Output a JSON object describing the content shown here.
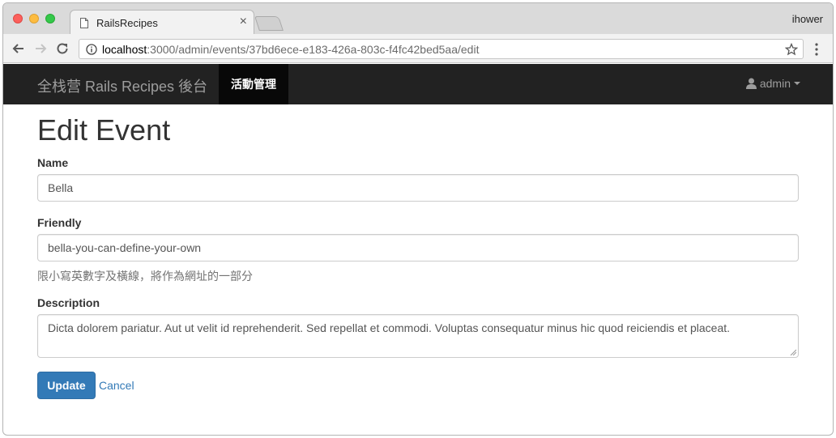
{
  "browser": {
    "tab_title": "RailsRecipes",
    "profile_name": "ihower",
    "url_host": "localhost",
    "url_path": ":3000/admin/events/37bd6ece-e183-426a-803c-f4fc42bed5aa/edit"
  },
  "navbar": {
    "brand": "全栈营 Rails Recipes 後台",
    "active_item": "活動管理",
    "user_label": "admin"
  },
  "page": {
    "title": "Edit Event"
  },
  "form": {
    "name_label": "Name",
    "name_value": "Bella",
    "friendly_label": "Friendly",
    "friendly_value": "bella-you-can-define-your-own",
    "friendly_help": "限小寫英數字及橫線，將作為網址的一部分",
    "description_label": "Description",
    "description_value": "Dicta dolorem pariatur. Aut ut velit id reprehenderit. Sed repellat et commodi. Voluptas consequatur minus hic quod reiciendis et placeat.",
    "update_label": "Update",
    "cancel_label": "Cancel"
  },
  "colors": {
    "navbar_bg": "#222222",
    "primary": "#337ab7"
  },
  "icons": [
    "document-icon",
    "close-icon",
    "back-arrow-icon",
    "forward-arrow-icon",
    "reload-icon",
    "info-icon",
    "star-icon",
    "menu-dots-icon",
    "user-icon",
    "caret-down-icon"
  ]
}
